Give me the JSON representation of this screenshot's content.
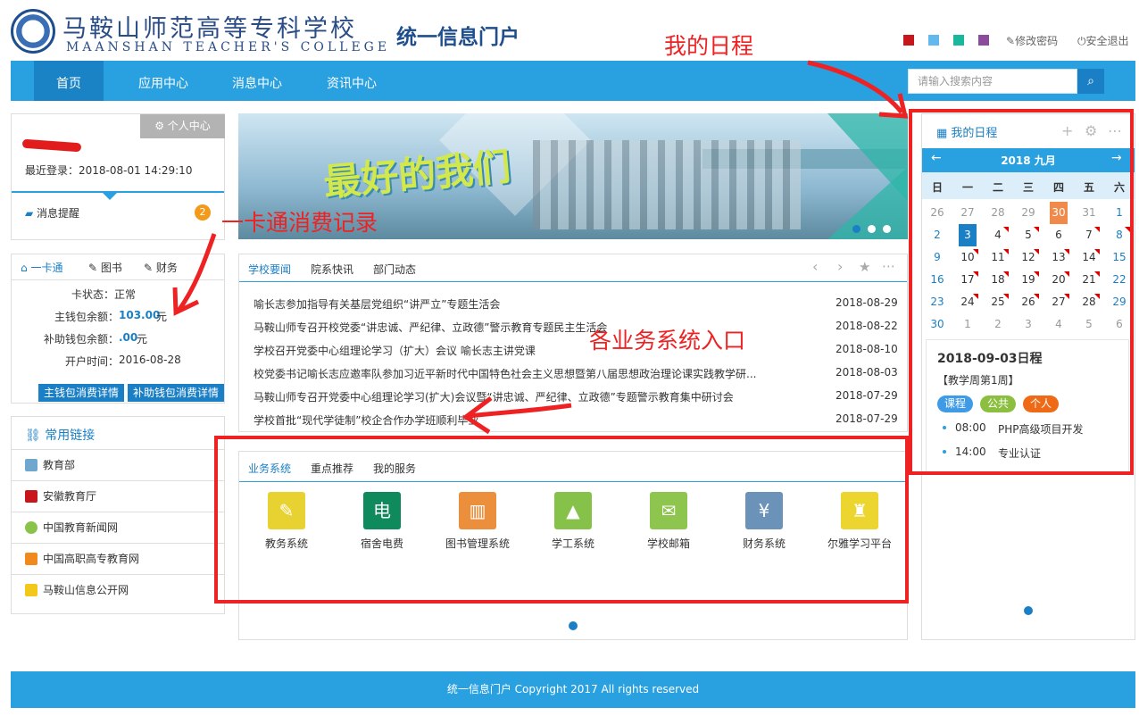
{
  "header": {
    "school_name_cn": "马鞍山师范高等专科学校",
    "school_name_en": "MAANSHAN TEACHER'S COLLEGE",
    "portal_title": "统一信息门户",
    "theme_colors": [
      "#c8161d",
      "#63b8ee",
      "#19b89c",
      "#8a4c9b"
    ],
    "change_password": "修改密码",
    "logout": "安全退出"
  },
  "nav": {
    "items": [
      "首页",
      "应用中心",
      "消息中心",
      "资讯中心"
    ],
    "search_placeholder": "请输入搜索内容"
  },
  "user": {
    "personal_center": "个人中心",
    "last_login": "最近登录：2018-08-01 14:29:10",
    "message_label": "消息提醒",
    "message_count": "2"
  },
  "card": {
    "tabs": [
      "一卡通",
      "图书",
      "财务"
    ],
    "rows": [
      {
        "label": "卡状态：",
        "value": "正常",
        "unit": ""
      },
      {
        "label": "主钱包余额：",
        "value": "103.00",
        "unit": "元"
      },
      {
        "label": "补助钱包余额：",
        "value": ".00",
        "unit": "元"
      },
      {
        "label": "开户时间：",
        "value": "2016-08-28",
        "unit": ""
      }
    ],
    "btn_main": "主钱包消费详情",
    "btn_sub": "补助钱包消费详情"
  },
  "links": {
    "title": "常用链接",
    "items": [
      {
        "label": "教育部",
        "icon": "monitor-icon",
        "color": "#6fa7cf"
      },
      {
        "label": "安徽教育厅",
        "icon": "red-logo-icon",
        "color": "#c8161d"
      },
      {
        "label": "中国教育新闻网",
        "icon": "globe-icon",
        "color": "#8ac34a"
      },
      {
        "label": "中国高职高专教育网",
        "icon": "orange-logo-icon",
        "color": "#f08a1c"
      },
      {
        "label": "马鞍山信息公开网",
        "icon": "info-icon",
        "color": "#f2c81a"
      }
    ]
  },
  "banner": {
    "text": "最好的我们"
  },
  "news": {
    "tabs": [
      "学校要闻",
      "院系快讯",
      "部门动态"
    ],
    "items": [
      {
        "title": "喻长志参加指导有关基层党组织“讲严立”专题生活会",
        "date": "2018-08-29"
      },
      {
        "title": "马鞍山师专召开校党委“讲忠诚、严纪律、立政德”警示教育专题民主生活会",
        "date": "2018-08-22"
      },
      {
        "title": "学校召开党委中心组理论学习（扩大）会议 喻长志主讲党课",
        "date": "2018-08-10"
      },
      {
        "title": "校党委书记喻长志应邀率队参加习近平新时代中国特色社会主义思想暨第八届思想政治理论课实践教学研...",
        "date": "2018-08-03"
      },
      {
        "title": "马鞍山师专召开党委中心组理论学习(扩大)会议暨“讲忠诚、严纪律、立政德”专题警示教育集中研讨会",
        "date": "2018-07-29"
      },
      {
        "title": "学校首批“现代学徒制”校企合作办学班顺利毕业",
        "date": "2018-07-29"
      }
    ]
  },
  "services": {
    "tabs": [
      "业务系统",
      "重点推荐",
      "我的服务"
    ],
    "items": [
      {
        "label": "教务系统",
        "icon": "cert-icon",
        "color": "#e8d232",
        "glyph": "✎"
      },
      {
        "label": "宿舍电费",
        "icon": "electricity-icon",
        "color": "#0e8a5c",
        "glyph": "电"
      },
      {
        "label": "图书管理系统",
        "icon": "books-icon",
        "color": "#ec8f3c",
        "glyph": "▥"
      },
      {
        "label": "学工系统",
        "icon": "graduation-cap-icon",
        "color": "#86c24a",
        "glyph": "🎓"
      },
      {
        "label": "学校邮箱",
        "icon": "mail-icon",
        "color": "#8dc54f",
        "glyph": "✉"
      },
      {
        "label": "财务系统",
        "icon": "finance-icon",
        "color": "#6b92b8",
        "glyph": "¥"
      },
      {
        "label": "尔雅学习平台",
        "icon": "lectern-icon",
        "color": "#ecd52f",
        "glyph": "♜"
      }
    ]
  },
  "schedule": {
    "title": "我的日程",
    "month_label": "2018 九月",
    "weekdays": [
      "日",
      "一",
      "二",
      "三",
      "四",
      "五",
      "六"
    ],
    "weeks": [
      [
        "26",
        "27",
        "28",
        "29",
        "30",
        "31",
        "1"
      ],
      [
        "2",
        "3",
        "4",
        "5",
        "6",
        "7",
        "8"
      ],
      [
        "9",
        "10",
        "11",
        "12",
        "13",
        "14",
        "15"
      ],
      [
        "16",
        "17",
        "18",
        "19",
        "20",
        "21",
        "22"
      ],
      [
        "23",
        "24",
        "25",
        "26",
        "27",
        "28",
        "29"
      ],
      [
        "30",
        "1",
        "2",
        "3",
        "4",
        "5",
        "6"
      ]
    ],
    "detail_date": "2018-09-03日程",
    "detail_week": "【教学周第1周】",
    "chips": [
      {
        "label": "课程",
        "color": "#3f9be6"
      },
      {
        "label": "公共",
        "color": "#8cbf3f"
      },
      {
        "label": "个人",
        "color": "#ef6a16"
      }
    ],
    "events": [
      {
        "time": "08:00",
        "text": "PHP高级项目开发"
      },
      {
        "time": "14:00",
        "text": "专业认证"
      }
    ]
  },
  "footer": {
    "text": "统一信息门户 Copyright 2017 All rights reserved"
  },
  "annotations": {
    "schedule_label": "我的日程",
    "card_label": "一卡通消费记录",
    "business_label": "各业务系统入口",
    "color": "#ee2222"
  }
}
